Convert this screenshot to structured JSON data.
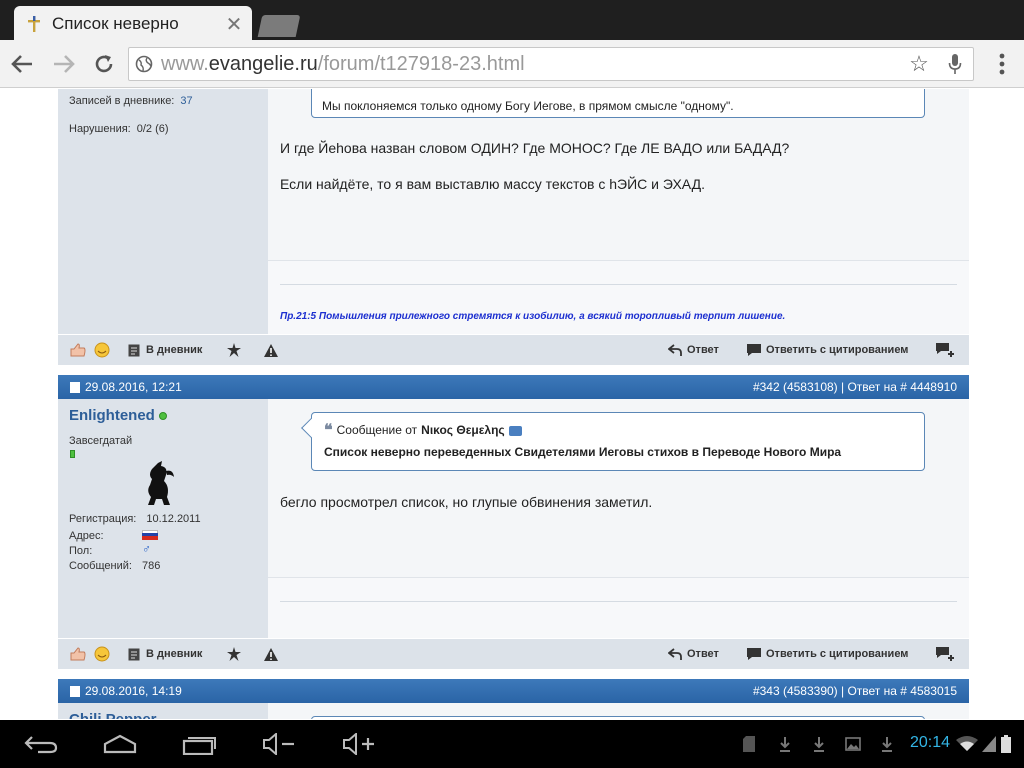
{
  "browser": {
    "tab_title": "Список неверно",
    "url_prefix": "www.",
    "url_host": "evangelie.ru",
    "url_path": "/forum/t127918-23.html"
  },
  "post_prev": {
    "userinfo": {
      "diary_label": "Записей в дневнике:",
      "diary_value": "37",
      "violations_label": "Нарушения:",
      "violations_value": "0/2 (6)"
    },
    "quote_text": "Мы поклоняемся только одному Богу Иегове, в прямом смысле \"одному\".",
    "paragraphs": [
      "И где Йеhова назван словом ОДИН? Где МОНОС? Где ЛЕ ВАДО или БАДАД?",
      "Если найдёте, то я вам выставлю массу текстов с hЭЙС и ЭХАД."
    ],
    "signature": "Пр.21:5 Помышления прилежного стремятся к изобилию, а всякий торопливый терпит лишение."
  },
  "actions": {
    "diary": "В дневник",
    "reply": "Ответ",
    "reply_quote": "Ответить с цитированием"
  },
  "post_342": {
    "date": "29.08.2016, 12:21",
    "number": "#342 (4583108) | Ответ на # 4448910",
    "username": "Enlightened",
    "rank": "Завсегдатай",
    "reg_label": "Регистрация:",
    "reg_value": "10.12.2011",
    "address_label": "Адрес:",
    "gender_label": "Пол:",
    "messages_label": "Сообщений:",
    "messages_value": "786",
    "quote_prefix": "Сообщение от",
    "quote_author": "Νικος Θεμελης",
    "quote_text": "Список неверно переведенных Свидетелями Иеговы стихов в Переводе Нового Мира",
    "text": "бегло просмотрел список, но глупые обвинения заметил."
  },
  "post_343": {
    "date": "29.08.2016, 14:19",
    "number": "#343 (4583390) | Ответ на # 4583015",
    "username": "Chili Pepper"
  },
  "system": {
    "clock": "20:14"
  },
  "colors": {
    "accent": "#33b5e5",
    "post_header": "#2a64a6",
    "link": "#2d5e98",
    "signature": "#1c2fd0"
  }
}
